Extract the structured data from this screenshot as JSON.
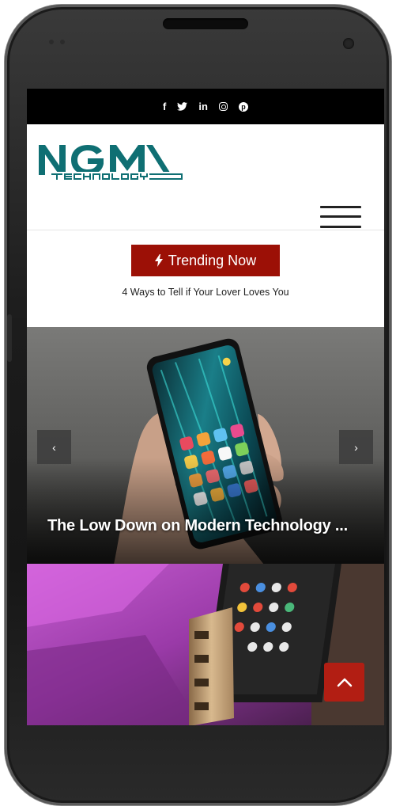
{
  "social": {
    "icons": [
      "facebook-icon",
      "twitter-icon",
      "linkedin-icon",
      "instagram-icon",
      "pinterest-icon"
    ],
    "facebook": "f",
    "twitter": "✓",
    "linkedin": "in",
    "pinterest": "p"
  },
  "header": {
    "logo_text": "NGM",
    "logo_subtext": "TECHNOLOGY",
    "menu_icon": "hamburger-icon"
  },
  "trending": {
    "label": "Trending Now",
    "headline": "4 Ways to Tell if Your Lover Loves You"
  },
  "slider": {
    "prev_label": "‹",
    "next_label": "›",
    "caption": "The Low Down on Modern Technology ..."
  },
  "scroll_top_icon": "chevron-up-icon",
  "colors": {
    "brand_teal": "#0f6f73",
    "trending_red": "#9c1006",
    "scroll_top_red": "#b21e13",
    "topbar_black": "#000000"
  }
}
